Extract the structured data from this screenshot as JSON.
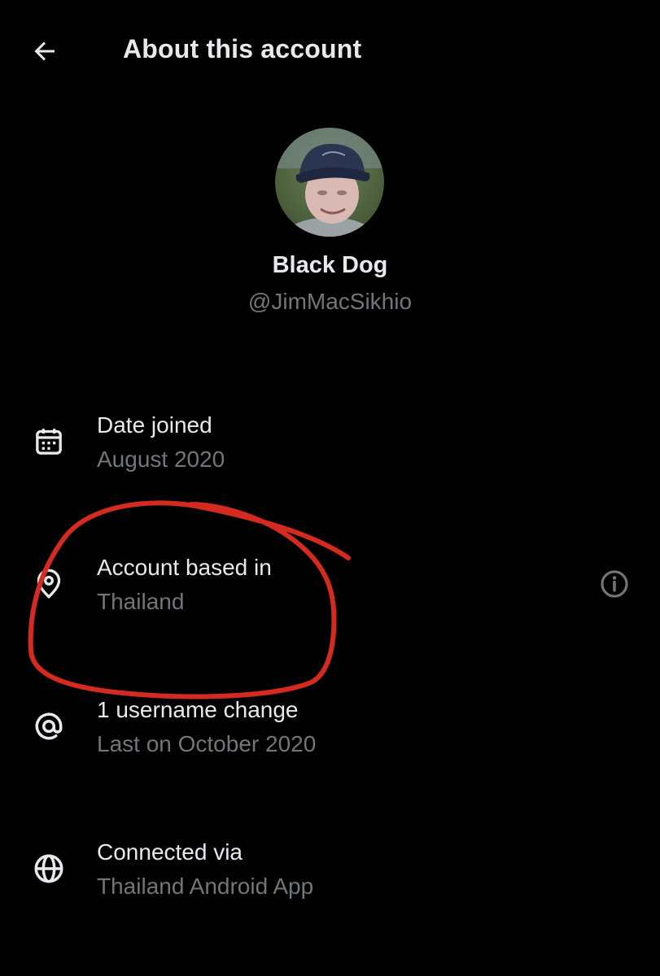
{
  "header": {
    "title": "About this account",
    "back_icon": "arrow-left-icon"
  },
  "profile": {
    "display_name": "Black Dog",
    "handle": "@JimMacSikhio"
  },
  "details": [
    {
      "icon": "calendar-icon",
      "label": "Date joined",
      "value": "August 2020"
    },
    {
      "icon": "location-pin-icon",
      "label": "Account based in",
      "value": "Thailand",
      "info_icon": "info-icon"
    },
    {
      "icon": "at-sign-icon",
      "label": "1 username change",
      "value": "Last on October 2020"
    },
    {
      "icon": "globe-icon",
      "label": "Connected via",
      "value": "Thailand Android App"
    }
  ],
  "colors": {
    "background": "#000000",
    "primary_text": "#e7e9ea",
    "secondary_text": "#71767b",
    "annotation_red": "#d42a1f"
  }
}
